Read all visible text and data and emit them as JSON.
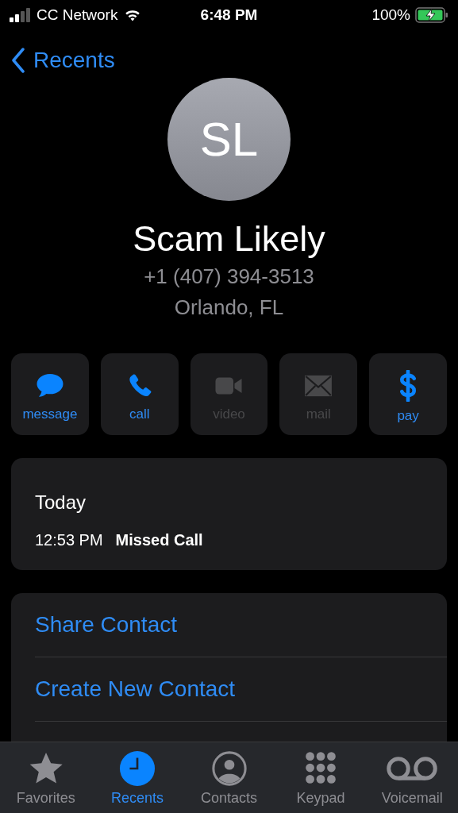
{
  "status_bar": {
    "carrier": "CC Network",
    "time": "6:48 PM",
    "battery": "100%"
  },
  "nav": {
    "back_label": "Recents"
  },
  "contact": {
    "initials": "SL",
    "name": "Scam Likely",
    "phone": "+1 (407) 394-3513",
    "location": "Orlando, FL"
  },
  "actions": [
    {
      "kind": "message",
      "label": "message",
      "disabled": false
    },
    {
      "kind": "call",
      "label": "call",
      "disabled": false
    },
    {
      "kind": "video",
      "label": "video",
      "disabled": true
    },
    {
      "kind": "mail",
      "label": "mail",
      "disabled": true
    },
    {
      "kind": "pay",
      "label": "pay",
      "disabled": false
    }
  ],
  "history": {
    "day": "Today",
    "entries": [
      {
        "time": "12:53 PM",
        "type": "Missed Call"
      }
    ]
  },
  "options": [
    "Share Contact",
    "Create New Contact"
  ],
  "tab_bar": [
    {
      "kind": "favorites",
      "label": "Favorites",
      "selected": false
    },
    {
      "kind": "recents",
      "label": "Recents",
      "selected": true
    },
    {
      "kind": "contacts",
      "label": "Contacts",
      "selected": false
    },
    {
      "kind": "keypad",
      "label": "Keypad",
      "selected": false
    },
    {
      "kind": "voicemail",
      "label": "Voicemail",
      "selected": false
    }
  ]
}
